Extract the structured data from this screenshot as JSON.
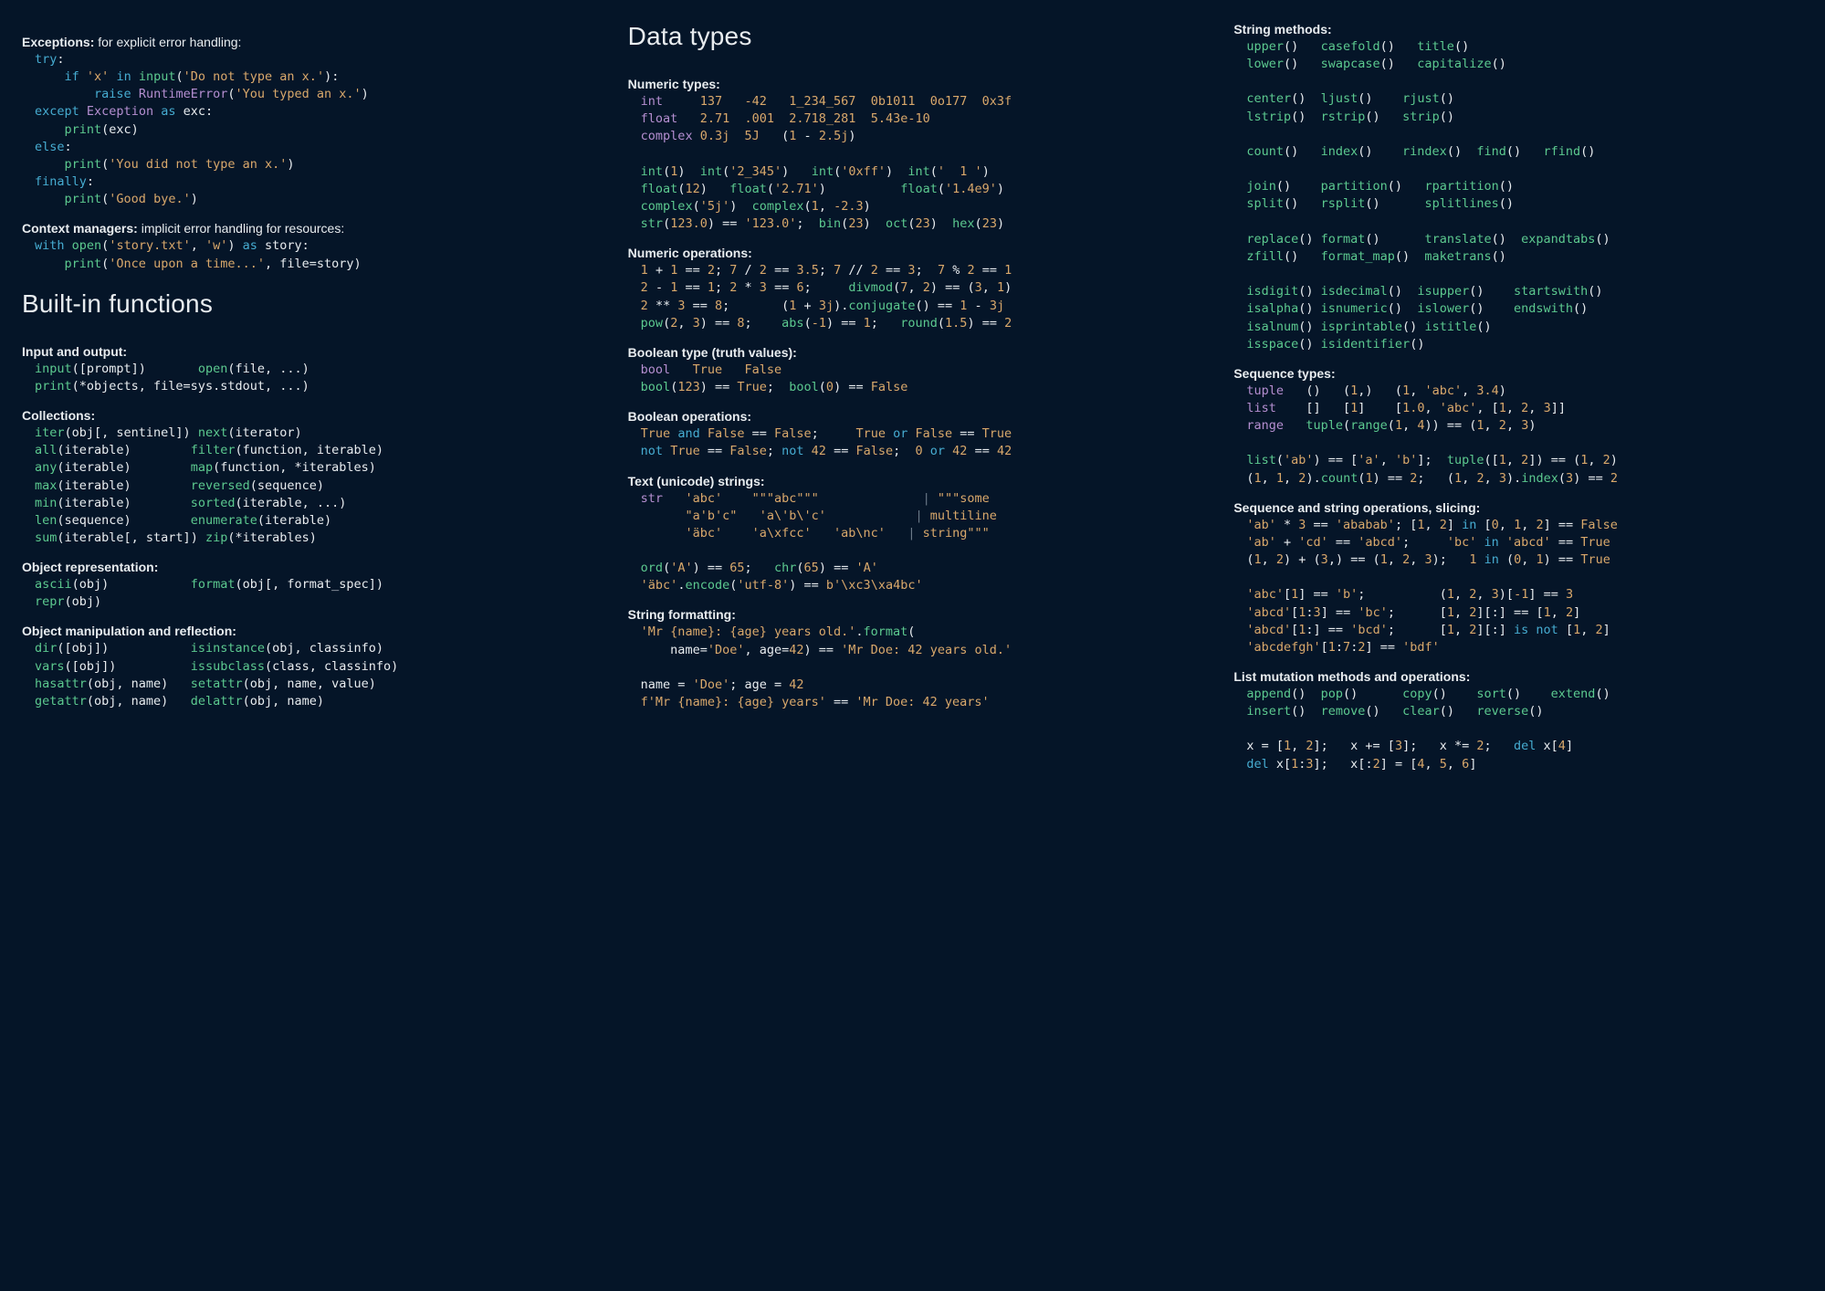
{
  "col1": {
    "exceptions": {
      "label": "Exceptions:",
      "desc": " for explicit error handling:",
      "code": "<span class='kw'>try</span>:\n    <span class='kw'>if</span> <span class='str'>'x'</span> <span class='kw'>in</span> <span class='fn'>input</span>(<span class='str'>'Do not type an x.'</span>):\n        <span class='kw'>raise</span> <span class='typ'>RuntimeError</span>(<span class='str'>'You typed an x.'</span>)\n<span class='kw'>except</span> <span class='typ'>Exception</span> <span class='kw'>as</span> exc:\n    <span class='fn'>print</span>(exc)\n<span class='kw'>else</span>:\n    <span class='fn'>print</span>(<span class='str'>'You did not type an x.'</span>)\n<span class='kw'>finally</span>:\n    <span class='fn'>print</span>(<span class='str'>'Good bye.'</span>)"
    },
    "context": {
      "label": "Context managers:",
      "desc": " implicit error handling for resources:",
      "code": "<span class='kw'>with</span> <span class='fn'>open</span>(<span class='str'>'story.txt'</span>, <span class='str'>'w'</span>) <span class='kw'>as</span> story:\n    <span class='fn'>print</span>(<span class='str'>'Once upon a time...'</span>, file=story)"
    },
    "builtins_heading": "Built-in functions",
    "io": {
      "label": "Input and output:",
      "code": "<span class='fn'>input</span>([prompt])       <span class='fn'>open</span>(file, ...)\n<span class='fn'>print</span>(*objects, file=sys.stdout, ...)"
    },
    "collections": {
      "label": "Collections:",
      "code": "<span class='fn'>iter</span>(obj[, sentinel]) <span class='fn'>next</span>(iterator)\n<span class='fn'>all</span>(iterable)        <span class='fn'>filter</span>(function, iterable)\n<span class='fn'>any</span>(iterable)        <span class='fn'>map</span>(function, *iterables)\n<span class='fn'>max</span>(iterable)        <span class='fn'>reversed</span>(sequence)\n<span class='fn'>min</span>(iterable)        <span class='fn'>sorted</span>(iterable, ...)\n<span class='fn'>len</span>(sequence)        <span class='fn'>enumerate</span>(iterable)\n<span class='fn'>sum</span>(iterable[, start]) <span class='fn'>zip</span>(*iterables)"
    },
    "repr": {
      "label": "Object representation:",
      "code": "<span class='fn'>ascii</span>(obj)           <span class='fn'>format</span>(obj[, format_spec])\n<span class='fn'>repr</span>(obj)"
    },
    "reflect": {
      "label": "Object manipulation and reflection:",
      "code": "<span class='fn'>dir</span>([obj])           <span class='fn'>isinstance</span>(obj, classinfo)\n<span class='fn'>vars</span>([obj])          <span class='fn'>issubclass</span>(class, classinfo)\n<span class='fn'>hasattr</span>(obj, name)   <span class='fn'>setattr</span>(obj, name, value)\n<span class='fn'>getattr</span>(obj, name)   <span class='fn'>delattr</span>(obj, name)"
    }
  },
  "col2": {
    "heading": "Data types",
    "numtypes": {
      "label": "Numeric types:",
      "code": "<span class='typ'>int</span>     <span class='num'>137</span>   <span class='num'>-42</span>   <span class='num'>1_234_567</span>  <span class='num'>0b1011</span>  <span class='num'>0o177</span>  <span class='num'>0x3f</span>\n<span class='typ'>float</span>   <span class='num'>2.71</span>  <span class='num'>.001</span>  <span class='num'>2.718_281</span>  <span class='num'>5.43e-10</span>\n<span class='typ'>complex</span> <span class='num'>0.3j</span>  <span class='num'>5J</span>   (<span class='num'>1</span> - <span class='num'>2.5j</span>)\n\n<span class='fn'>int</span>(<span class='num'>1</span>)  <span class='fn'>int</span>(<span class='str'>'2_345'</span>)   <span class='fn'>int</span>(<span class='str'>'0xff'</span>)  <span class='fn'>int</span>(<span class='str'>'  1 '</span>)\n<span class='fn'>float</span>(<span class='num'>12</span>)   <span class='fn'>float</span>(<span class='str'>'2.71'</span>)          <span class='fn'>float</span>(<span class='str'>'1.4e9'</span>)\n<span class='fn'>complex</span>(<span class='str'>'5j'</span>)  <span class='fn'>complex</span>(<span class='num'>1</span>, <span class='num'>-2.3</span>)\n<span class='fn'>str</span>(<span class='num'>123.0</span>) == <span class='str'>'123.0'</span>;  <span class='fn'>bin</span>(<span class='num'>23</span>)  <span class='fn'>oct</span>(<span class='num'>23</span>)  <span class='fn'>hex</span>(<span class='num'>23</span>)"
    },
    "numops": {
      "label": "Numeric operations:",
      "code": "<span class='num'>1</span> + <span class='num'>1</span> == <span class='num'>2</span>; <span class='num'>7</span> / <span class='num'>2</span> == <span class='num'>3.5</span>; <span class='num'>7</span> // <span class='num'>2</span> == <span class='num'>3</span>;  <span class='num'>7</span> % <span class='num'>2</span> == <span class='num'>1</span>\n<span class='num'>2</span> - <span class='num'>1</span> == <span class='num'>1</span>; <span class='num'>2</span> * <span class='num'>3</span> == <span class='num'>6</span>;     <span class='fn'>divmod</span>(<span class='num'>7</span>, <span class='num'>2</span>) == (<span class='num'>3</span>, <span class='num'>1</span>)\n<span class='num'>2</span> ** <span class='num'>3</span> == <span class='num'>8</span>;       (<span class='num'>1</span> + <span class='num'>3j</span>).<span class='fn'>conjugate</span>() == <span class='num'>1</span> - <span class='num'>3j</span>\n<span class='fn'>pow</span>(<span class='num'>2</span>, <span class='num'>3</span>) == <span class='num'>8</span>;    <span class='fn'>abs</span>(<span class='num'>-1</span>) == <span class='num'>1</span>;   <span class='fn'>round</span>(<span class='num'>1.5</span>) == <span class='num'>2</span>"
    },
    "booltype": {
      "label": "Boolean type (truth values):",
      "code": "<span class='typ'>bool</span>   <span class='bool'>True</span>   <span class='bool'>False</span>\n<span class='fn'>bool</span>(<span class='num'>123</span>) == <span class='bool'>True</span>;  <span class='fn'>bool</span>(<span class='num'>0</span>) == <span class='bool'>False</span>"
    },
    "boolops": {
      "label": "Boolean operations:",
      "code": "<span class='bool'>True</span> <span class='kw'>and</span> <span class='bool'>False</span> == <span class='bool'>False</span>;     <span class='bool'>True</span> <span class='kw'>or</span> <span class='bool'>False</span> == <span class='bool'>True</span>\n<span class='kw'>not</span> <span class='bool'>True</span> == <span class='bool'>False</span>; <span class='kw'>not</span> <span class='num'>42</span> == <span class='bool'>False</span>;  <span class='num'>0</span> <span class='kw'>or</span> <span class='num'>42</span> == <span class='num'>42</span>"
    },
    "text": {
      "label": "Text (unicode) strings:",
      "code": "<span class='typ'>str</span>   <span class='str'>'abc'</span>    <span class='str'>\"\"\"abc\"\"\"</span>              <span class='sep'>|</span> <span class='str'>\"\"\"some</span>\n      <span class='str'>\"a'b'c\"</span>   <span class='str'>'a\\'b\\'c'</span>            <span class='sep'>|</span> <span class='str'>multiline</span>\n      <span class='str'>'äbc'</span>    <span class='str'>'a\\xfcc'</span>   <span class='str'>'ab\\nc'</span>   <span class='sep'>|</span> <span class='str'>string\"\"\"</span>\n\n<span class='fn'>ord</span>(<span class='str'>'A'</span>) == <span class='num'>65</span>;   <span class='fn'>chr</span>(<span class='num'>65</span>) == <span class='str'>'A'</span>\n<span class='str'>'äbc'</span>.<span class='fn'>encode</span>(<span class='str'>'utf-8'</span>) == <span class='str'>b'\\xc3\\xa4bc'</span>"
    },
    "strfmt": {
      "label": "String formatting:",
      "code": "<span class='str'>'Mr {name}: {age} years old.'</span>.<span class='fn'>format</span>(\n    name=<span class='str'>'Doe'</span>, age=<span class='num'>42</span>) == <span class='str'>'Mr Doe: 42 years old.'</span>\n\nname = <span class='str'>'Doe'</span>; age = <span class='num'>42</span>\n<span class='str'>f'Mr {name}: {age} years'</span> == <span class='str'>'Mr Doe: 42 years'</span>"
    }
  },
  "col3": {
    "strmethods": {
      "label": "String methods:",
      "code": "<span class='fn'>upper</span>()   <span class='fn'>casefold</span>()   <span class='fn'>title</span>()\n<span class='fn'>lower</span>()   <span class='fn'>swapcase</span>()   <span class='fn'>capitalize</span>()\n\n<span class='fn'>center</span>()  <span class='fn'>ljust</span>()    <span class='fn'>rjust</span>()\n<span class='fn'>lstrip</span>()  <span class='fn'>rstrip</span>()   <span class='fn'>strip</span>()\n\n<span class='fn'>count</span>()   <span class='fn'>index</span>()    <span class='fn'>rindex</span>()  <span class='fn'>find</span>()   <span class='fn'>rfind</span>()\n\n<span class='fn'>join</span>()    <span class='fn'>partition</span>()   <span class='fn'>rpartition</span>()\n<span class='fn'>split</span>()   <span class='fn'>rsplit</span>()      <span class='fn'>splitlines</span>()\n\n<span class='fn'>replace</span>() <span class='fn'>format</span>()      <span class='fn'>translate</span>()  <span class='fn'>expandtabs</span>()\n<span class='fn'>zfill</span>()   <span class='fn'>format_map</span>()  <span class='fn'>maketrans</span>()\n\n<span class='fn'>isdigit</span>() <span class='fn'>isdecimal</span>()  <span class='fn'>isupper</span>()    <span class='fn'>startswith</span>()\n<span class='fn'>isalpha</span>() <span class='fn'>isnumeric</span>()  <span class='fn'>islower</span>()    <span class='fn'>endswith</span>()\n<span class='fn'>isalnum</span>() <span class='fn'>isprintable</span>() <span class='fn'>istitle</span>()\n<span class='fn'>isspace</span>() <span class='fn'>isidentifier</span>()"
    },
    "seqtypes": {
      "label": "Sequence types:",
      "code": "<span class='typ'>tuple</span>   ()   (<span class='num'>1</span>,)   (<span class='num'>1</span>, <span class='str'>'abc'</span>, <span class='num'>3.4</span>)\n<span class='typ'>list</span>    []   [<span class='num'>1</span>]    [<span class='num'>1.0</span>, <span class='str'>'abc'</span>, [<span class='num'>1</span>, <span class='num'>2</span>, <span class='num'>3</span>]]\n<span class='typ'>range</span>   <span class='fn'>tuple</span>(<span class='fn'>range</span>(<span class='num'>1</span>, <span class='num'>4</span>)) == (<span class='num'>1</span>, <span class='num'>2</span>, <span class='num'>3</span>)\n\n<span class='fn'>list</span>(<span class='str'>'ab'</span>) == [<span class='str'>'a'</span>, <span class='str'>'b'</span>];  <span class='fn'>tuple</span>([<span class='num'>1</span>, <span class='num'>2</span>]) == (<span class='num'>1</span>, <span class='num'>2</span>)\n(<span class='num'>1</span>, <span class='num'>1</span>, <span class='num'>2</span>).<span class='fn'>count</span>(<span class='num'>1</span>) == <span class='num'>2</span>;   (<span class='num'>1</span>, <span class='num'>2</span>, <span class='num'>3</span>).<span class='fn'>index</span>(<span class='num'>3</span>) == <span class='num'>2</span>"
    },
    "seqops": {
      "label": "Sequence and string operations, slicing:",
      "code": "<span class='str'>'ab'</span> * <span class='num'>3</span> == <span class='str'>'ababab'</span>; [<span class='num'>1</span>, <span class='num'>2</span>] <span class='kw'>in</span> [<span class='num'>0</span>, <span class='num'>1</span>, <span class='num'>2</span>] == <span class='bool'>False</span>\n<span class='str'>'ab'</span> + <span class='str'>'cd'</span> == <span class='str'>'abcd'</span>;     <span class='str'>'bc'</span> <span class='kw'>in</span> <span class='str'>'abcd'</span> == <span class='bool'>True</span>\n(<span class='num'>1</span>, <span class='num'>2</span>) + (<span class='num'>3</span>,) == (<span class='num'>1</span>, <span class='num'>2</span>, <span class='num'>3</span>);   <span class='num'>1</span> <span class='kw'>in</span> (<span class='num'>0</span>, <span class='num'>1</span>) == <span class='bool'>True</span>\n\n<span class='str'>'abc'</span>[<span class='num'>1</span>] == <span class='str'>'b'</span>;          (<span class='num'>1</span>, <span class='num'>2</span>, <span class='num'>3</span>)[<span class='num'>-1</span>] == <span class='num'>3</span>\n<span class='str'>'abcd'</span>[<span class='num'>1</span>:<span class='num'>3</span>] == <span class='str'>'bc'</span>;      [<span class='num'>1</span>, <span class='num'>2</span>][:] == [<span class='num'>1</span>, <span class='num'>2</span>]\n<span class='str'>'abcd'</span>[<span class='num'>1</span>:] == <span class='str'>'bcd'</span>;      [<span class='num'>1</span>, <span class='num'>2</span>][:] <span class='kw'>is not</span> [<span class='num'>1</span>, <span class='num'>2</span>]\n<span class='str'>'abcdefgh'</span>[<span class='num'>1</span>:<span class='num'>7</span>:<span class='num'>2</span>] == <span class='str'>'bdf'</span>"
    },
    "listmut": {
      "label": "List mutation methods and operations:",
      "code": "<span class='fn'>append</span>()  <span class='fn'>pop</span>()      <span class='fn'>copy</span>()    <span class='fn'>sort</span>()    <span class='fn'>extend</span>()\n<span class='fn'>insert</span>()  <span class='fn'>remove</span>()   <span class='fn'>clear</span>()   <span class='fn'>reverse</span>()\n\nx = [<span class='num'>1</span>, <span class='num'>2</span>];   x += [<span class='num'>3</span>];   x *= <span class='num'>2</span>;   <span class='kw'>del</span> x[<span class='num'>4</span>]\n<span class='kw'>del</span> x[<span class='num'>1</span>:<span class='num'>3</span>];   x[:<span class='num'>2</span>] = [<span class='num'>4</span>, <span class='num'>5</span>, <span class='num'>6</span>]"
    }
  }
}
